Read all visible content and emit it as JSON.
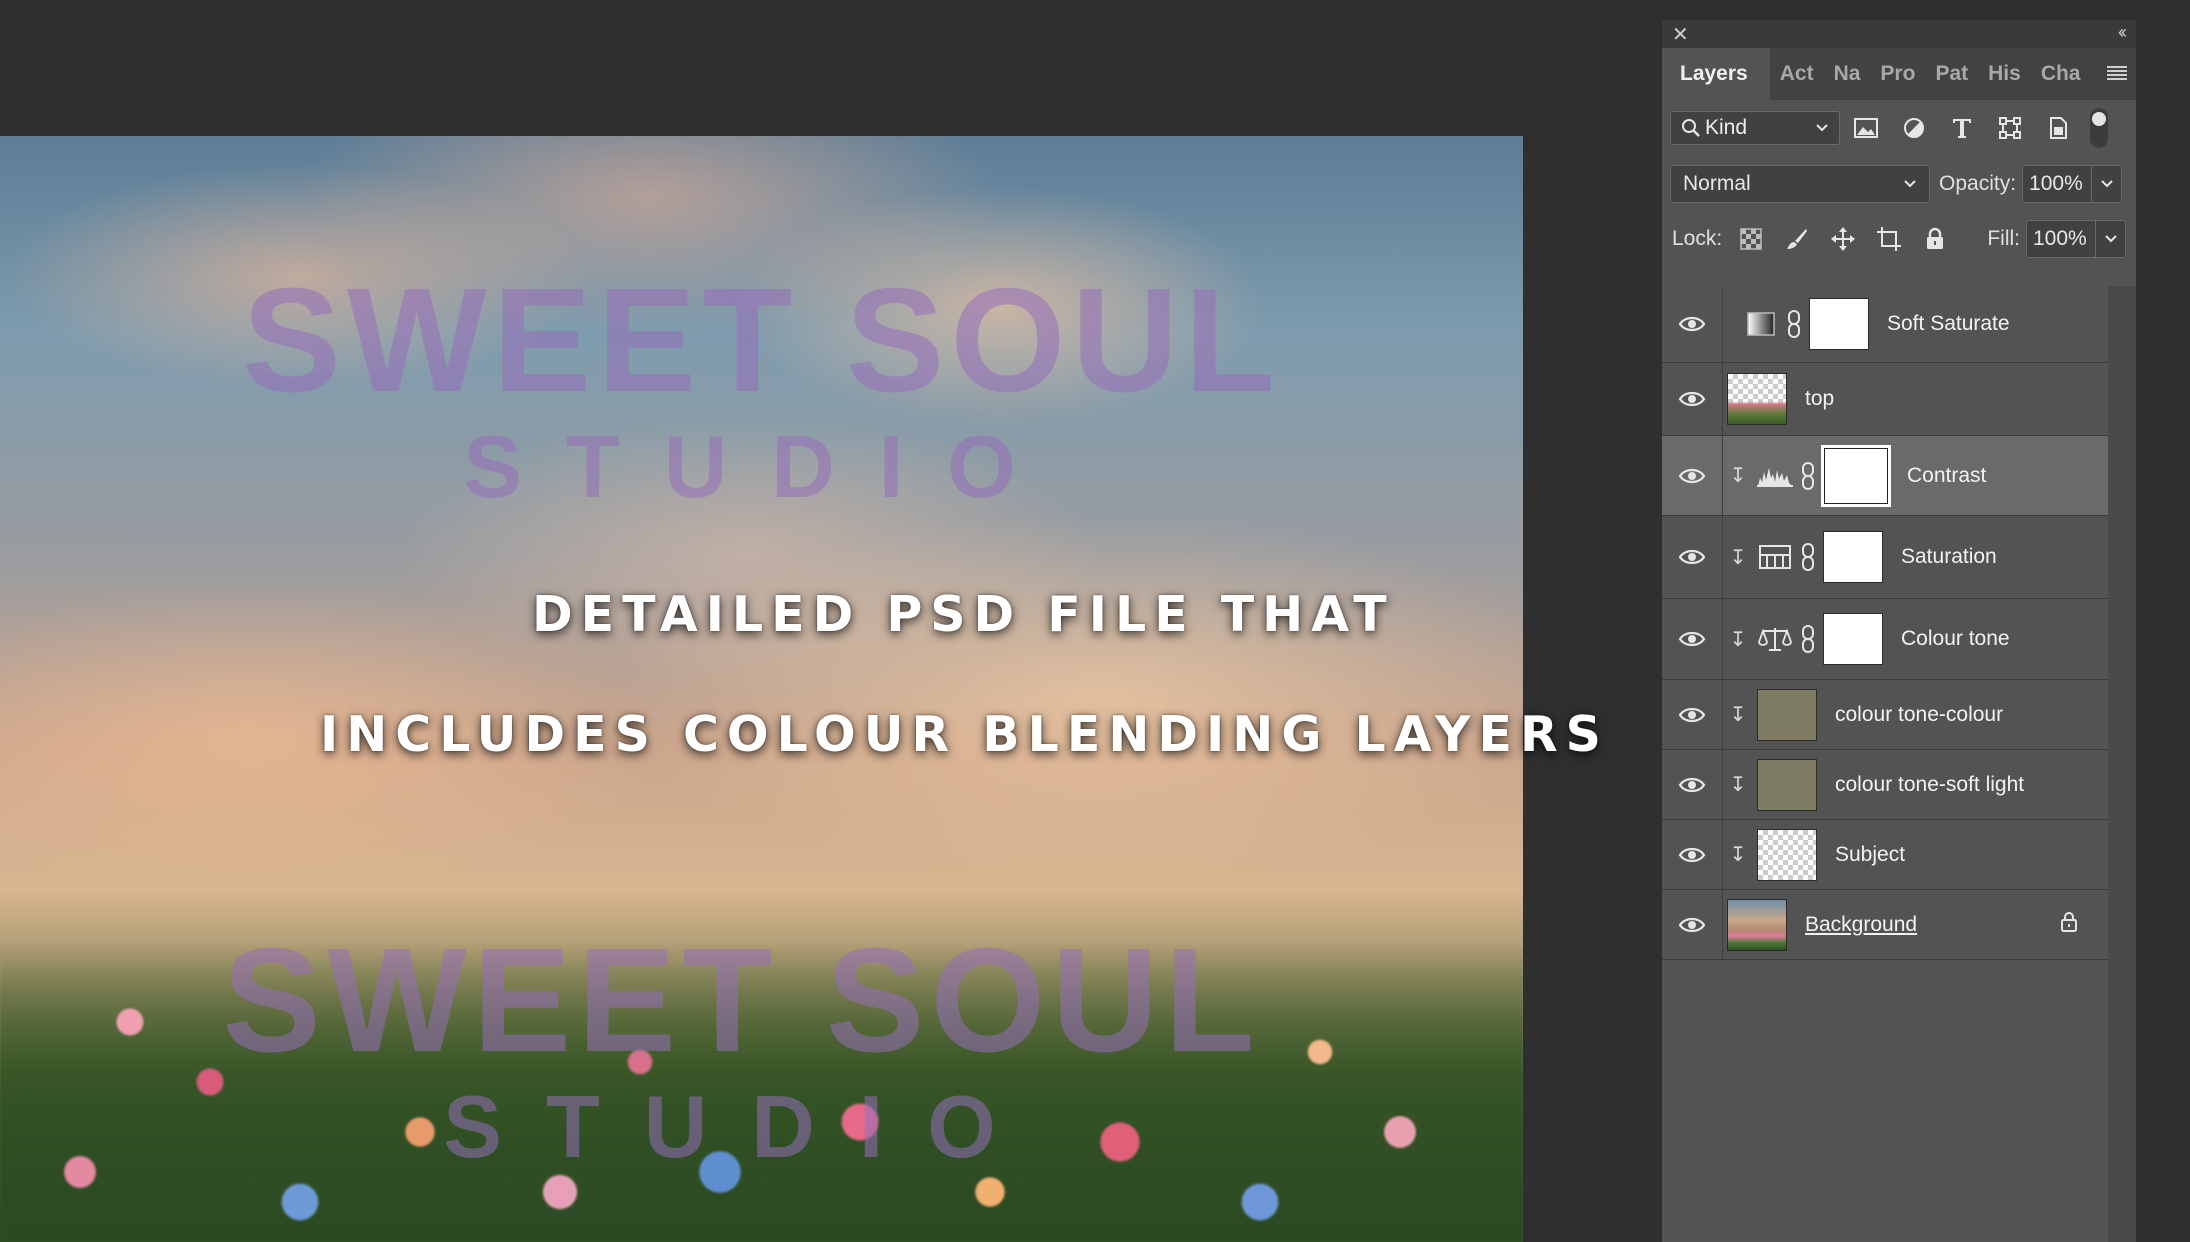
{
  "canvas": {
    "watermark_top_title": "SWEET SOUL",
    "watermark_top_sub": "STUDIO",
    "caption_line1": "DETAILED PSD FILE THAT",
    "caption_line2": "INCLUDES COLOUR BLENDING LAYERS",
    "watermark_bottom_title": "SWEET SOUL",
    "watermark_bottom_sub": "STUDIO"
  },
  "panel": {
    "close_glyph": "✕",
    "collapse_glyph": "‹‹",
    "tabs": [
      {
        "label": "Layers",
        "active": true
      },
      {
        "label": "Act"
      },
      {
        "label": "Na"
      },
      {
        "label": "Pro"
      },
      {
        "label": "Pat"
      },
      {
        "label": "His"
      },
      {
        "label": "Cha"
      }
    ],
    "filter": {
      "kind_label": "Kind",
      "icons": [
        "image-filter-icon",
        "adjustment-filter-icon",
        "type-filter-icon",
        "shape-filter-icon",
        "smart-object-filter-icon"
      ]
    },
    "blend_mode": "Normal",
    "opacity_label": "Opacity:",
    "opacity_value": "100%",
    "lock_label": "Lock:",
    "fill_label": "Fill:",
    "fill_value": "100%",
    "layers": [
      {
        "name": "Soft Saturate",
        "type": "gradient-adjustment",
        "clipped": false,
        "thumb": "white",
        "selected": false
      },
      {
        "name": "top",
        "type": "pixel",
        "clipped": false,
        "thumb": "topimg",
        "selected": false
      },
      {
        "name": "Contrast",
        "type": "levels-adjustment",
        "clipped": true,
        "thumb": "white",
        "selected": true
      },
      {
        "name": "Saturation",
        "type": "hue-saturation-adjustment",
        "clipped": true,
        "thumb": "white",
        "selected": false
      },
      {
        "name": "Colour tone",
        "type": "color-balance-adjustment",
        "clipped": true,
        "thumb": "white",
        "selected": false
      },
      {
        "name": "colour tone-colour",
        "type": "pixel",
        "clipped": true,
        "thumb": "olive",
        "selected": false
      },
      {
        "name": "colour tone-soft light",
        "type": "pixel",
        "clipped": true,
        "thumb": "olive",
        "selected": false
      },
      {
        "name": "Subject",
        "type": "pixel",
        "clipped": true,
        "thumb": "checker",
        "selected": false
      },
      {
        "name": "Background",
        "type": "background",
        "clipped": false,
        "thumb": "bgimg",
        "selected": false,
        "locked": true
      }
    ]
  }
}
